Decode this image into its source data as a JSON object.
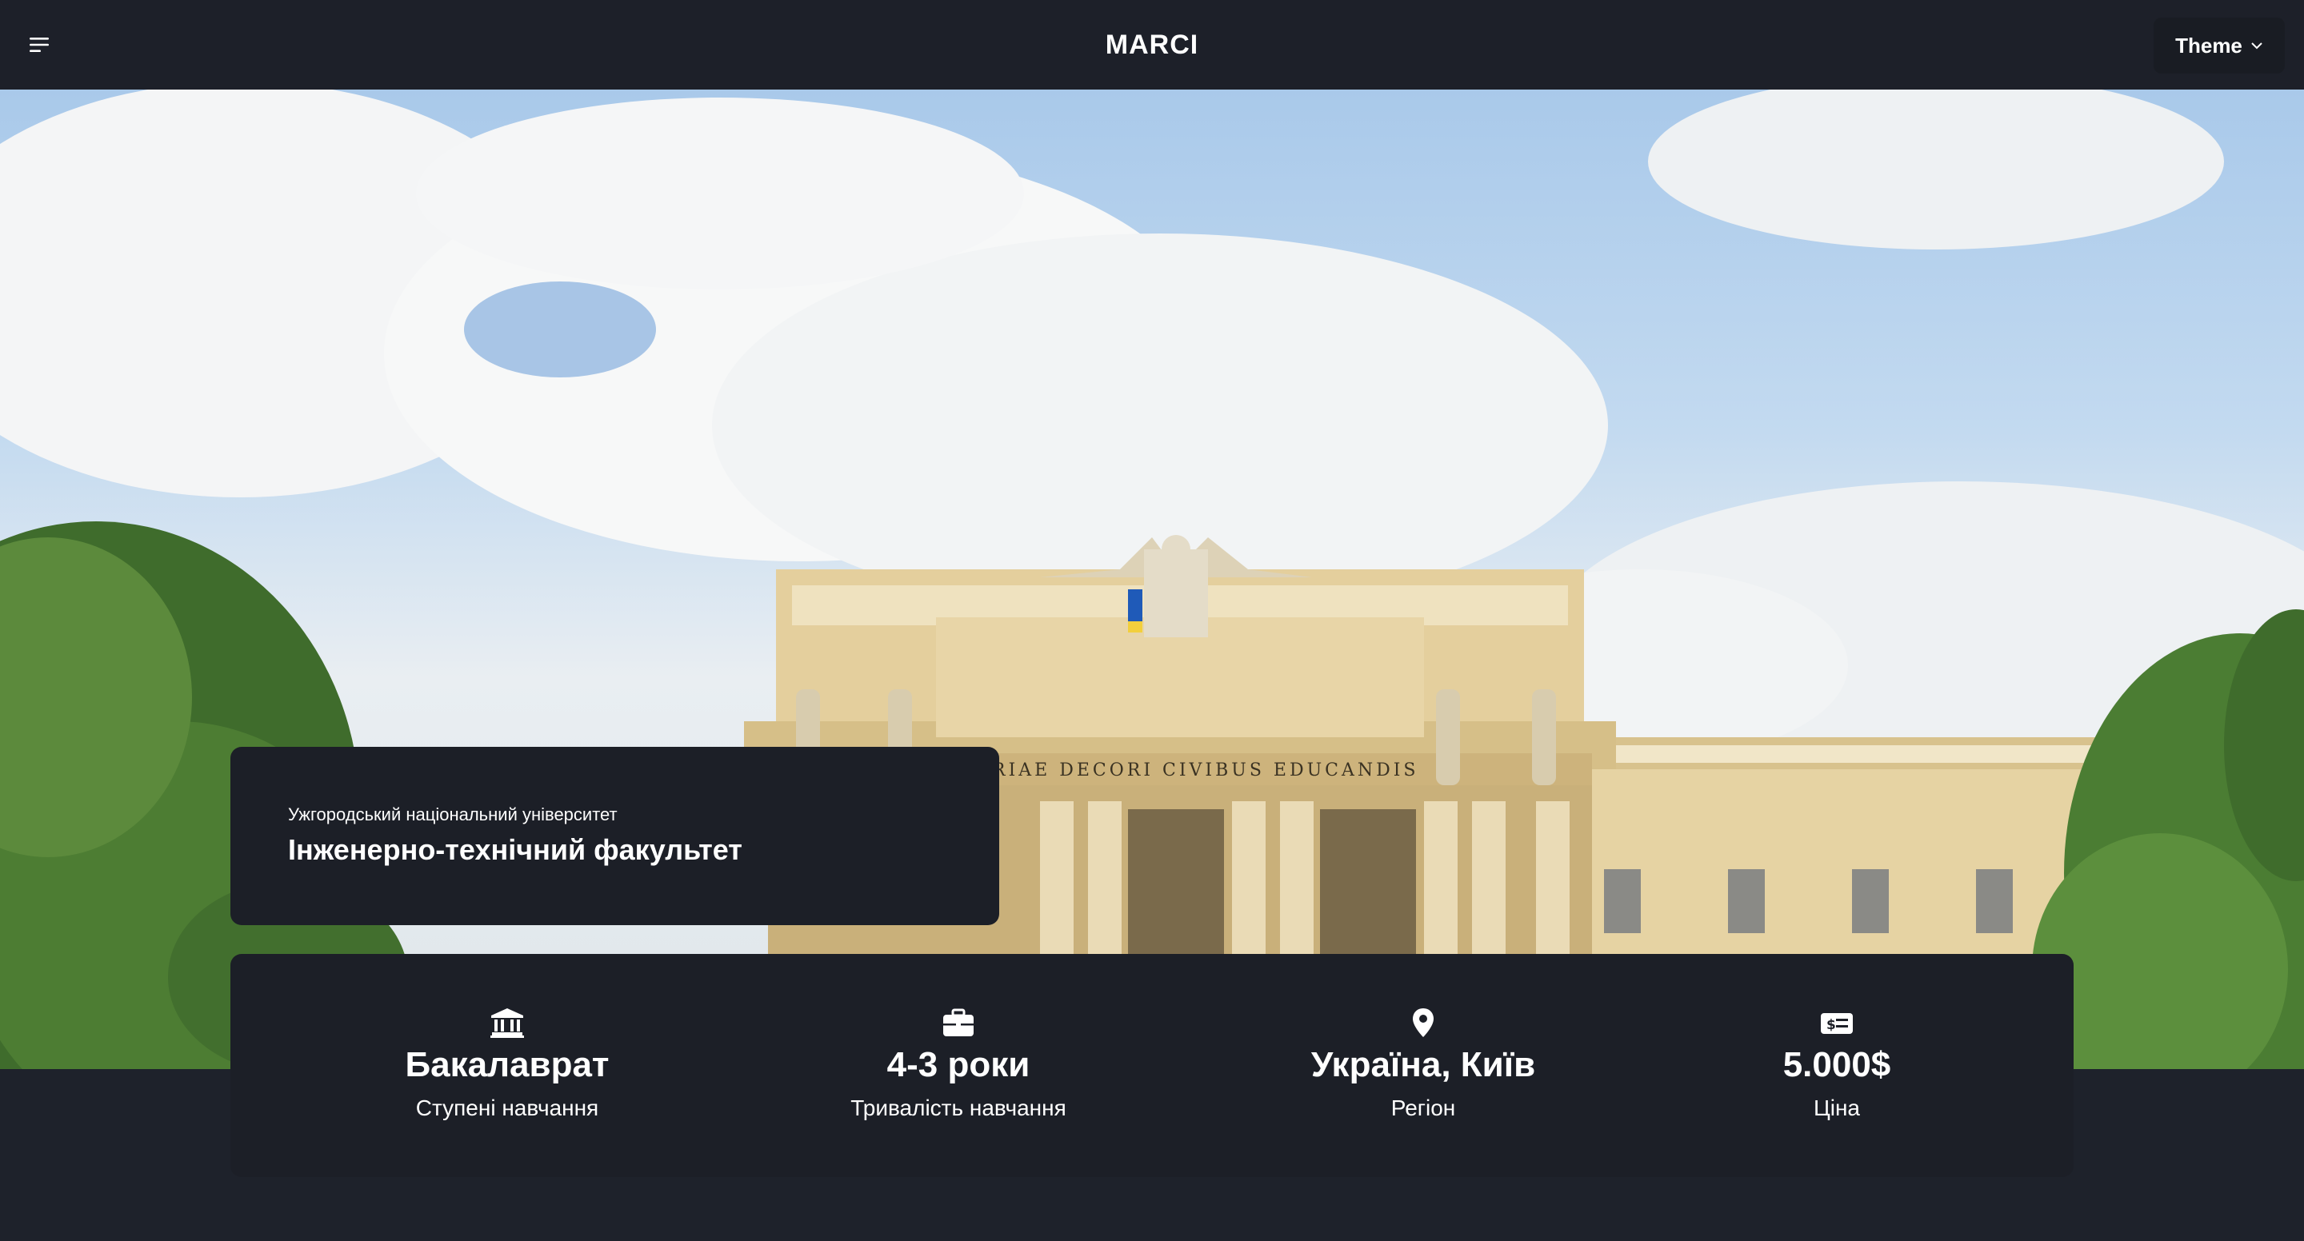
{
  "navbar": {
    "brand": "MARCI",
    "theme_label": "Theme"
  },
  "hero": {
    "inscription": "RIAE DECORI CIVIBUS EDUCANDIS"
  },
  "faculty": {
    "university": "Ужгородський національний університет",
    "name": "Інженерно-технічний факультет"
  },
  "stats": [
    {
      "icon": "university-icon",
      "value": "Бакалаврат",
      "label": "Ступені навчання"
    },
    {
      "icon": "briefcase-icon",
      "value": "4-3 роки",
      "label": "Тривалість навчання"
    },
    {
      "icon": "location-pin-icon",
      "value": "Україна, Київ",
      "label": "Регіон"
    },
    {
      "icon": "money-bill-icon",
      "value": "5.000$",
      "label": "Ціна"
    }
  ],
  "colors": {
    "navbar_bg": "#1d2029",
    "card_bg": "#1c1f27",
    "page_bg": "#1e222b",
    "text": "#ffffff"
  }
}
